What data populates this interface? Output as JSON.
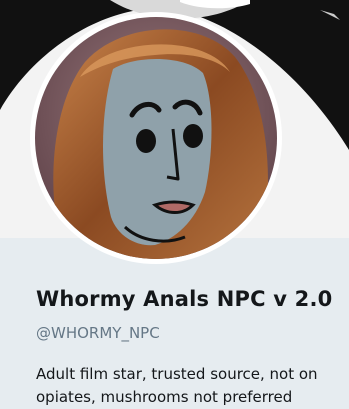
{
  "profile": {
    "display_name": "Whormy Anals NPC v 2.0",
    "handle": "@WHORMY_NPC",
    "bio": "Adult film star, trusted source, not on opiates, mushrooms not preferred"
  },
  "icons": {
    "avatar": "npc-face-avatar-icon",
    "banner": "npc-banner-image"
  },
  "colors": {
    "page_background": "#e6ecf0",
    "name_text": "#14171a",
    "handle_text": "#657786",
    "npc_skin": "#8fa1aa",
    "hair": "#a0522d"
  }
}
